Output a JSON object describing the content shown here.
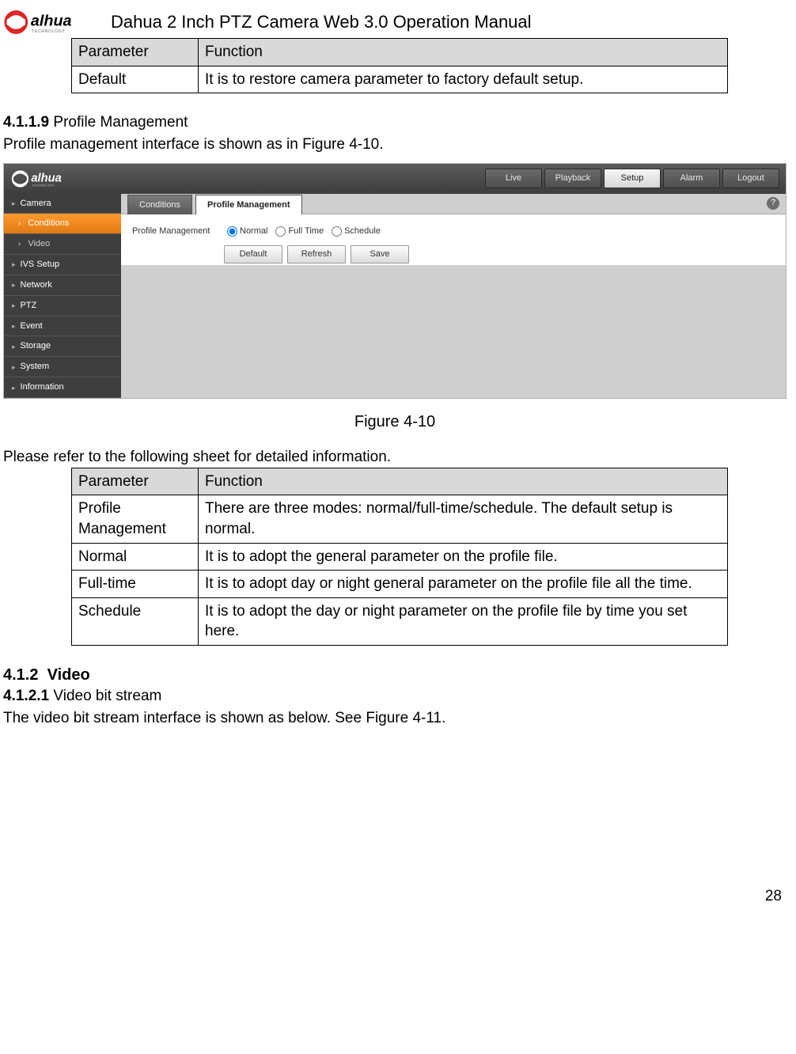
{
  "header": {
    "title": "Dahua 2 Inch PTZ Camera Web 3.0 Operation Manual"
  },
  "table1": {
    "head_param": "Parameter",
    "head_func": "Function",
    "rows": [
      {
        "param": "Default",
        "func": "It is to restore camera parameter to factory default setup."
      }
    ]
  },
  "sec_4119": {
    "num": "4.1.1.9",
    "title": "Profile Management",
    "intro": "Profile management interface is shown as in Figure 4-10."
  },
  "screenshot": {
    "topnav": {
      "live": "Live",
      "playback": "Playback",
      "setup": "Setup",
      "alarm": "Alarm",
      "logout": "Logout"
    },
    "sidebar": {
      "camera": "Camera",
      "conditions": "Conditions",
      "video": "Video",
      "ivs": "IVS Setup",
      "network": "Network",
      "ptz": "PTZ",
      "event": "Event",
      "storage": "Storage",
      "system": "System",
      "information": "Information"
    },
    "subtabs": {
      "conditions": "Conditions",
      "profile": "Profile Management"
    },
    "form": {
      "label": "Profile Management",
      "normal": "Normal",
      "fulltime": "Full Time",
      "schedule": "Schedule",
      "btn_default": "Default",
      "btn_refresh": "Refresh",
      "btn_save": "Save"
    },
    "help": "?"
  },
  "fig_caption": "Figure 4-10",
  "before_table2": "Please refer to the following sheet for detailed information.",
  "table2": {
    "head_param": "Parameter",
    "head_func": "Function",
    "rows": [
      {
        "param": "Profile Management",
        "func": "There are three modes: normal/full-time/schedule. The default setup is normal."
      },
      {
        "param": "Normal",
        "func": "It is to adopt the general parameter on the profile file."
      },
      {
        "param": "Full-time",
        "func": "It is to adopt day or night general parameter on the profile file all the time."
      },
      {
        "param": "Schedule",
        "func": "It is to adopt the day or night parameter on the profile file by time you set here."
      }
    ]
  },
  "sec_412": {
    "num": "4.1.2",
    "title": "Video"
  },
  "sec_4121": {
    "num": "4.1.2.1",
    "title": "Video bit stream",
    "intro": "The video bit stream interface is shown as below. See Figure 4-11."
  },
  "page_number": "28"
}
